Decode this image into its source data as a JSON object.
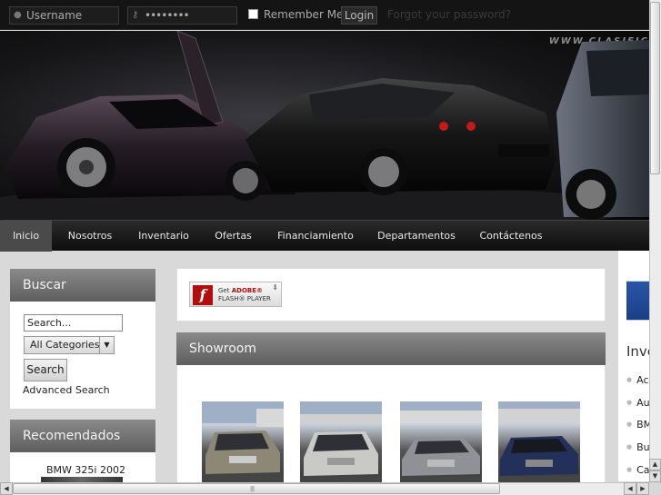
{
  "login": {
    "username_placeholder": "Username",
    "password_value": "••••••••",
    "remember_label": "Remember Me",
    "login_label": "Login",
    "forgot_label": "Forgot your password?"
  },
  "hero": {
    "url_text": "WWW.CLASIFIC"
  },
  "nav": {
    "items": [
      {
        "label": "Inicio"
      },
      {
        "label": "Nosotros"
      },
      {
        "label": "Inventario"
      },
      {
        "label": "Ofertas"
      },
      {
        "label": "Financiamiento"
      },
      {
        "label": "Departamentos"
      },
      {
        "label": "Contáctenos"
      }
    ]
  },
  "search": {
    "title": "Buscar",
    "input_value": "Search...",
    "category_value": "All Categories",
    "button_label": "Search",
    "advanced_label": "Advanced Search"
  },
  "recommended": {
    "title": "Recomendados",
    "item_label": "BMW 325i 2002"
  },
  "flash": {
    "line1_prefix": "Get",
    "line1_brand": "ADOBE®",
    "line2": "FLASH® PLAYER"
  },
  "showroom": {
    "title": "Showroom"
  },
  "right": {
    "heading": "Inve",
    "items": [
      {
        "label": "Ac"
      },
      {
        "label": "Au"
      },
      {
        "label": "BM"
      },
      {
        "label": "Bu"
      },
      {
        "label": "Ca"
      }
    ]
  },
  "colors": {
    "brand_dark": "#141414",
    "panel_header": "#6f6f6f",
    "flash_red": "#b10d0d"
  },
  "icons": {
    "username": "user-icon",
    "password": "key-icon",
    "flash": "flash-icon"
  }
}
